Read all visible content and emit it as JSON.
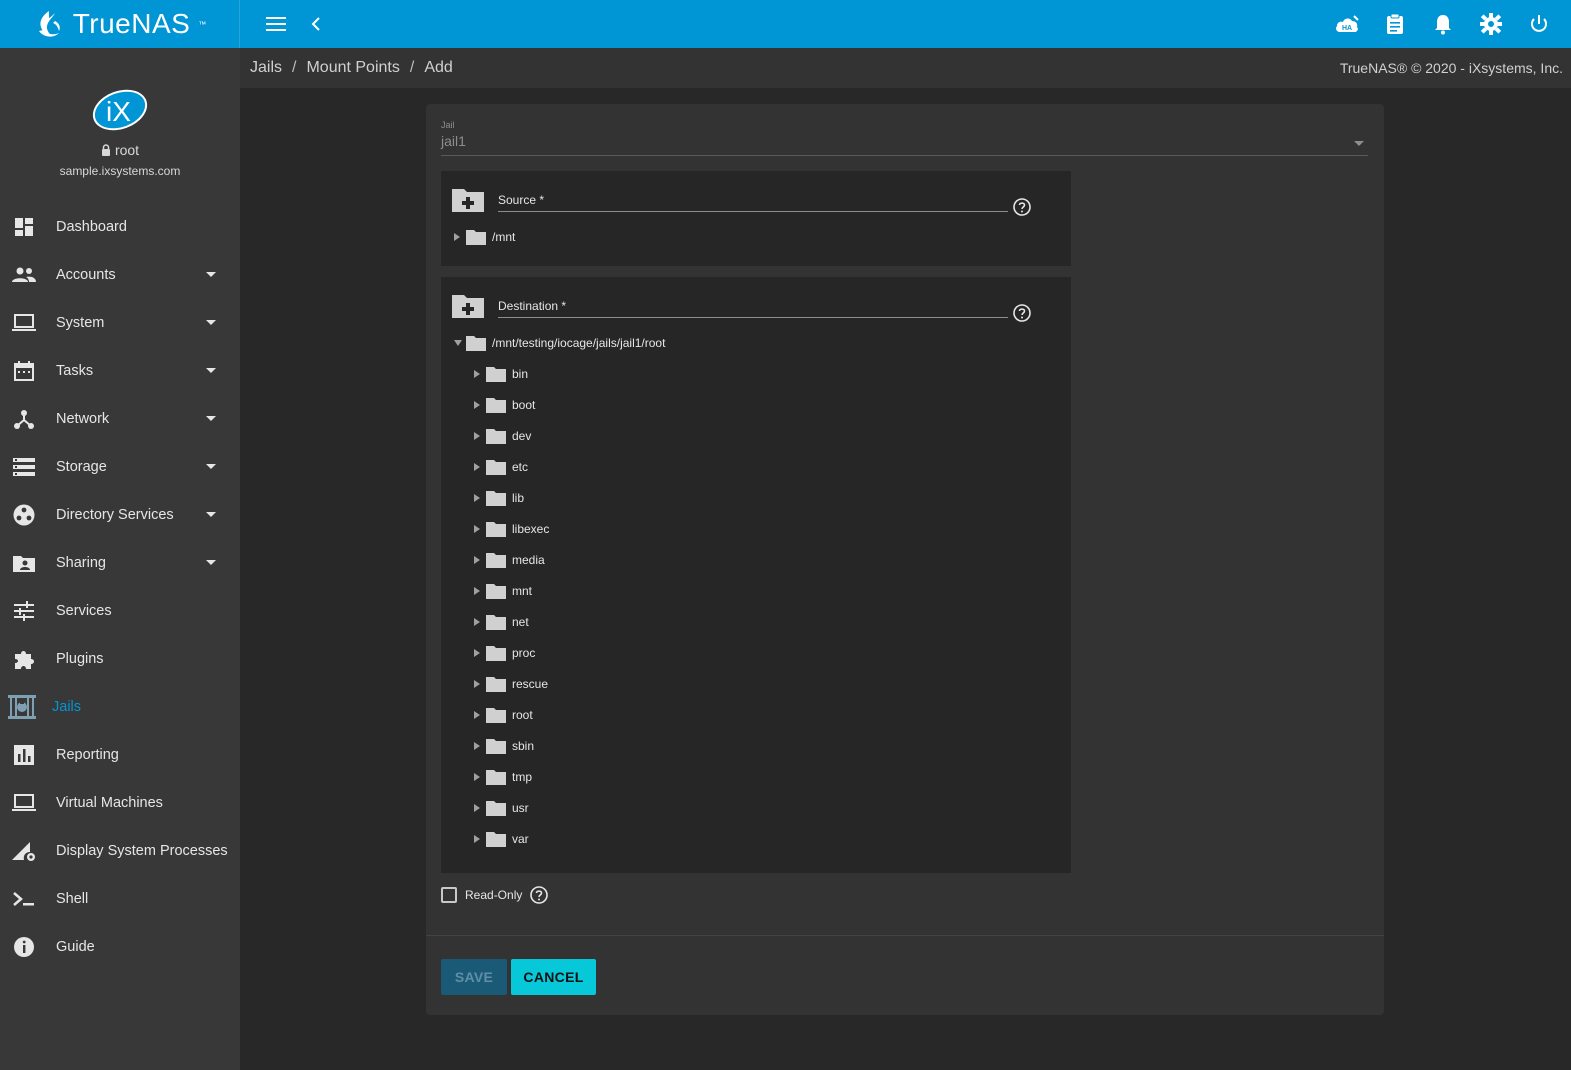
{
  "header": {
    "brand": "TrueNAS",
    "brand_tm": "™"
  },
  "profile": {
    "username": "root",
    "hostname": "sample.ixsystems.com"
  },
  "sidebar": {
    "items": [
      {
        "label": "Dashboard",
        "icon": "dashboard-icon"
      },
      {
        "label": "Accounts",
        "icon": "accounts-icon"
      },
      {
        "label": "System",
        "icon": "system-icon"
      },
      {
        "label": "Tasks",
        "icon": "tasks-icon"
      },
      {
        "label": "Network",
        "icon": "network-icon"
      },
      {
        "label": "Storage",
        "icon": "storage-icon"
      },
      {
        "label": "Directory Services",
        "icon": "directory-services-icon"
      },
      {
        "label": "Sharing",
        "icon": "sharing-icon"
      },
      {
        "label": "Services",
        "icon": "services-icon"
      },
      {
        "label": "Plugins",
        "icon": "plugins-icon"
      },
      {
        "label": "Jails",
        "icon": "jails-icon"
      },
      {
        "label": "Reporting",
        "icon": "reporting-icon"
      },
      {
        "label": "Virtual Machines",
        "icon": "virtual-machines-icon"
      },
      {
        "label": "Display System Processes",
        "icon": "system-processes-icon"
      },
      {
        "label": "Shell",
        "icon": "shell-icon"
      },
      {
        "label": "Guide",
        "icon": "guide-icon"
      }
    ],
    "active": "Jails",
    "accent_color": "#0095d5"
  },
  "breadcrumb": [
    "Jails",
    "Mount Points",
    "Add"
  ],
  "copyright": "TrueNAS® © 2020 - iXsystems, Inc.",
  "form": {
    "jail_label": "Jail",
    "jail_value": "jail1",
    "source": {
      "label": "Source *",
      "tree_root": "/mnt"
    },
    "destination": {
      "label": "Destination *",
      "tree_root": "/mnt/testing/iocage/jails/jail1/root",
      "children": [
        "bin",
        "boot",
        "dev",
        "etc",
        "lib",
        "libexec",
        "media",
        "mnt",
        "net",
        "proc",
        "rescue",
        "root",
        "sbin",
        "tmp",
        "usr",
        "var"
      ]
    },
    "readonly_label": "Read-Only",
    "save_label": "SAVE",
    "cancel_label": "CANCEL"
  },
  "colors": {
    "topbar": "#0095d5",
    "cancel_button": "#07c8d8",
    "save_button_disabled": "#1b5a77"
  }
}
